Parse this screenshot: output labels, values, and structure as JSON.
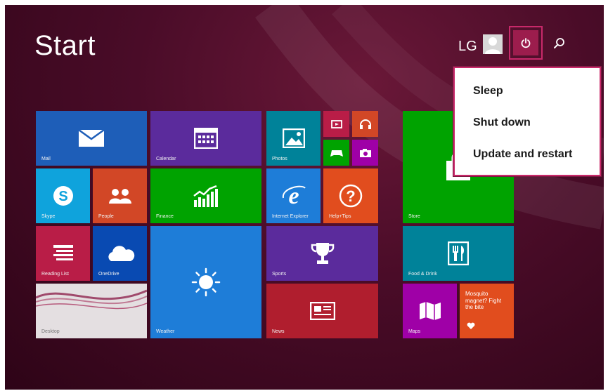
{
  "header": {
    "title": "Start",
    "user_name": "LG"
  },
  "icons": {
    "user_avatar": "user-avatar-icon",
    "power": "power-icon",
    "search": "search-icon"
  },
  "power_menu": {
    "items": [
      {
        "label": "Sleep"
      },
      {
        "label": "Shut down"
      },
      {
        "label": "Update and restart"
      }
    ]
  },
  "tiles": {
    "mail": {
      "label": "Mail",
      "color": "#1e5eb8"
    },
    "calendar": {
      "label": "Calendar",
      "color": "#5b2b9c"
    },
    "photos": {
      "label": "Photos",
      "color": "#008299"
    },
    "video": {
      "color": "#b91d47"
    },
    "music": {
      "color": "#d24726"
    },
    "games": {
      "color": "#00a300"
    },
    "camera": {
      "color": "#9f00a7"
    },
    "skype": {
      "label": "Skype",
      "color": "#0fa3dc"
    },
    "people": {
      "label": "People",
      "color": "#d24726"
    },
    "finance": {
      "label": "Finance",
      "color": "#00a300"
    },
    "internet_explorer": {
      "label": "Internet Explorer",
      "color": "#1e7dd8"
    },
    "help_tips": {
      "label": "Help+Tips",
      "color": "#e14d1e"
    },
    "store": {
      "label": "Store",
      "color": "#00a300"
    },
    "reading_list": {
      "label": "Reading List",
      "color": "#b91d47"
    },
    "onedrive": {
      "label": "OneDrive",
      "color": "#094ab2"
    },
    "sports": {
      "label": "Sports",
      "color": "#5b2b9c"
    },
    "food_drink": {
      "label": "Food & Drink",
      "color": "#008299"
    },
    "desktop": {
      "label": "Desktop",
      "color": "#d9d4d6"
    },
    "weather": {
      "label": "Weather",
      "color": "#1e7dd8"
    },
    "news": {
      "label": "News",
      "color": "#b01e2e"
    },
    "maps": {
      "label": "Maps",
      "color": "#9f00a7"
    },
    "health": {
      "text": "Mosquito magnet? Fight the bite",
      "color": "#e14d1e"
    }
  }
}
